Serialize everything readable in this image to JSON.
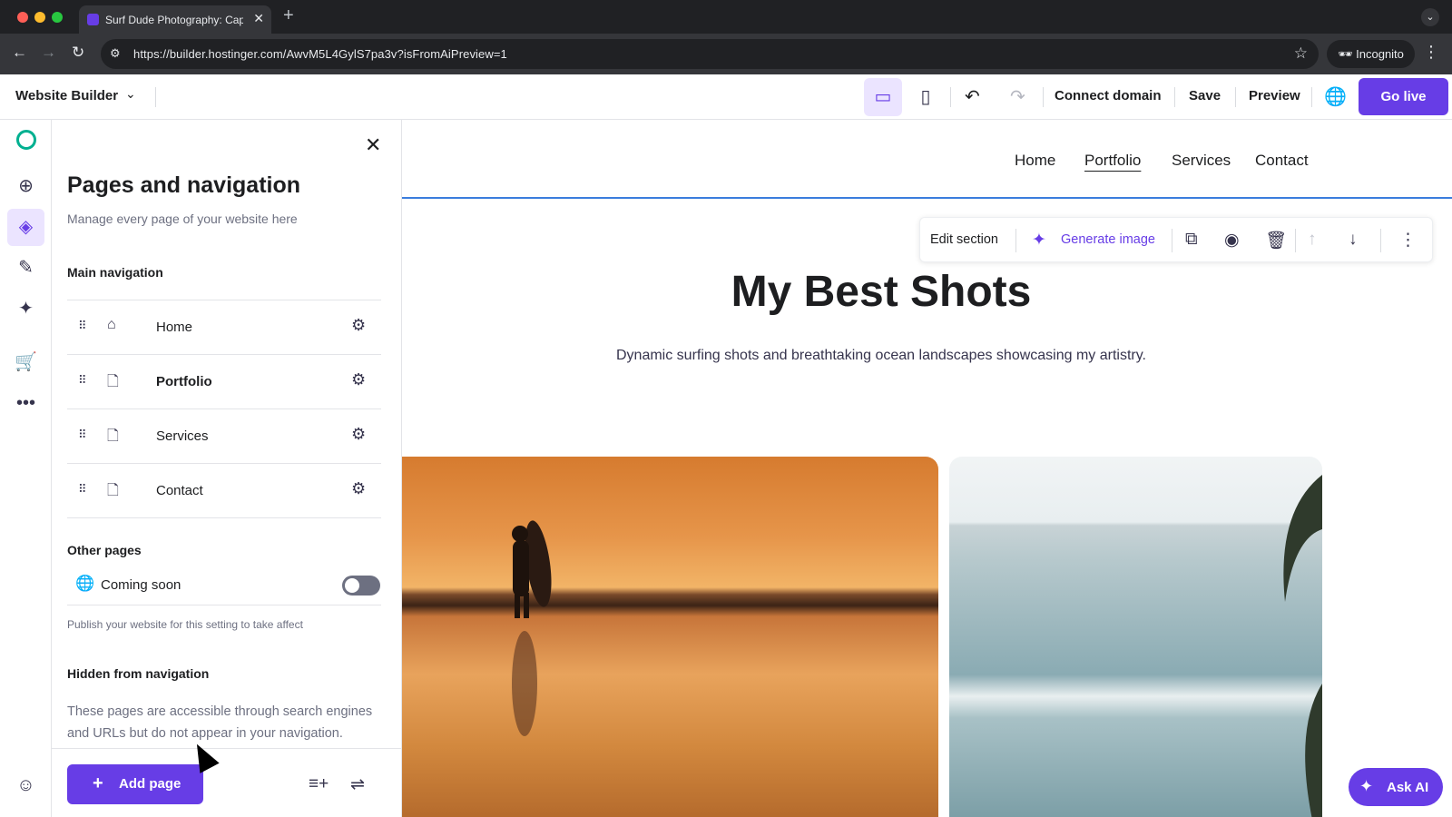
{
  "browser": {
    "tab_title": "Surf Dude Photography: Cap",
    "tab_close": "✕",
    "new_tab": "+",
    "url": "https://builder.hostinger.com/AwvM5L4GylS7pa3v?isFromAiPreview=1",
    "incognito_label": "Incognito",
    "traffic_colors": [
      "#ff5f57",
      "#febc2e",
      "#28c840"
    ]
  },
  "topbar": {
    "brand": "Website Builder",
    "connect_domain": "Connect domain",
    "save": "Save",
    "preview": "Preview",
    "go_live": "Go live"
  },
  "rail": {
    "items": [
      "add-element-icon",
      "layers-icon",
      "design-icon",
      "ai-tools-icon",
      "store-icon",
      "more-icon"
    ],
    "active": "layers-icon"
  },
  "panel": {
    "title": "Pages and navigation",
    "subtitle": "Manage every page of your website here",
    "main_nav_heading": "Main navigation",
    "pages": [
      {
        "label": "Home",
        "icon": "home-icon",
        "active": false
      },
      {
        "label": "Portfolio",
        "icon": "page-icon",
        "active": true
      },
      {
        "label": "Services",
        "icon": "page-icon",
        "active": false
      },
      {
        "label": "Contact",
        "icon": "page-icon",
        "active": false
      }
    ],
    "other_pages_heading": "Other pages",
    "coming_soon_label": "Coming soon",
    "coming_soon_enabled": false,
    "publish_note": "Publish your website for this setting to take affect",
    "hidden_heading": "Hidden from navigation",
    "hidden_desc": "These pages are accessible through search engines and URLs but do not appear in your navigation.",
    "add_page": "Add page"
  },
  "site": {
    "nav": [
      "Home",
      "Portfolio",
      "Services",
      "Contact"
    ],
    "active_nav": "Portfolio",
    "edit_section": "Edit section",
    "generate_image": "Generate image",
    "hero_title": "My Best Shots",
    "hero_subtitle": "Dynamic surfing shots and breathtaking ocean landscapes showcasing my artistry."
  },
  "ask_ai": "Ask AI",
  "colors": {
    "accent": "#673de6",
    "accent_light": "#ebe4ff",
    "selection_line": "#3b7ddd"
  }
}
